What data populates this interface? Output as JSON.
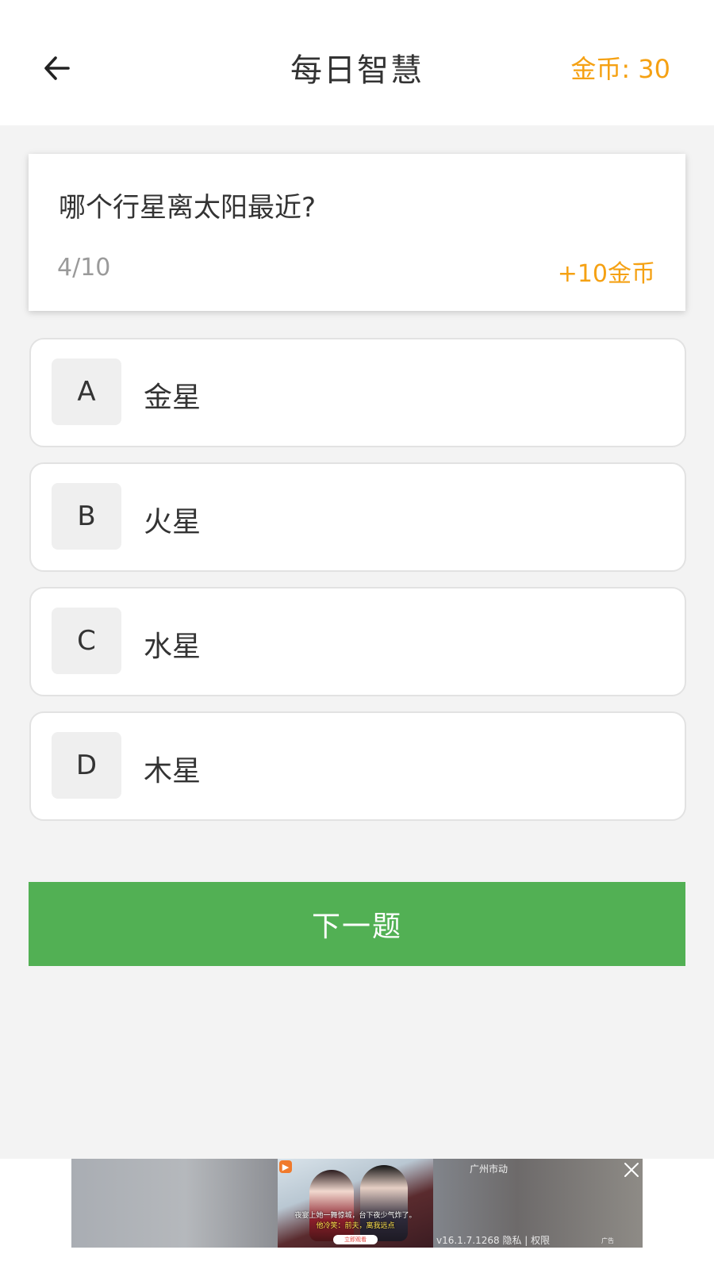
{
  "header": {
    "title": "每日智慧",
    "coins_label": "金币: 30",
    "back_icon": "arrow-left-icon"
  },
  "question": {
    "text": "哪个行星离太阳最近?",
    "progress": "4/10",
    "reward": "+10金币"
  },
  "options": [
    {
      "letter": "A",
      "text": "金星"
    },
    {
      "letter": "B",
      "text": "火星"
    },
    {
      "letter": "C",
      "text": "水星"
    },
    {
      "letter": "D",
      "text": "木星"
    }
  ],
  "next_button": "下一题",
  "ad": {
    "caption_line1": "夜宴上她一舞惊城，台下夜少气炸了。",
    "caption_line2": "他冷笑：前夫，离我远点",
    "cta": "立即观看",
    "advertiser": "广州市动",
    "meta": "v16.1.7.1268  隐私 | 权限",
    "label": "广告",
    "close_icon": "close-icon"
  },
  "colors": {
    "accent": "#f5a113",
    "primary_button": "#52b054",
    "background": "#f3f3f3",
    "text": "#333333",
    "muted": "#9a9a9a"
  }
}
